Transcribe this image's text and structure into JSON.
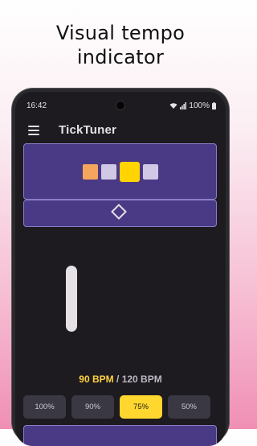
{
  "headline": {
    "line1": "Visual tempo",
    "line2": "indicator"
  },
  "status_bar": {
    "time": "16:42",
    "battery": "100%"
  },
  "app": {
    "title": "TickTuner"
  },
  "beats": {
    "count": 4,
    "accent_index": 0,
    "active_index": 2
  },
  "tempo": {
    "current": "90",
    "current_unit": "BPM",
    "separator": "/",
    "target": "120 BPM"
  },
  "speed_options": [
    "100%",
    "90%",
    "75%",
    "50%"
  ],
  "selected_speed": "75%",
  "colors": {
    "accent_yellow": "#ffd400",
    "panel_purple": "#4a3a86",
    "background": "#1d1b20"
  },
  "icons": [
    "menu-icon",
    "wifi-icon",
    "signal-icon",
    "battery-icon",
    "tap-diamond-icon"
  ]
}
